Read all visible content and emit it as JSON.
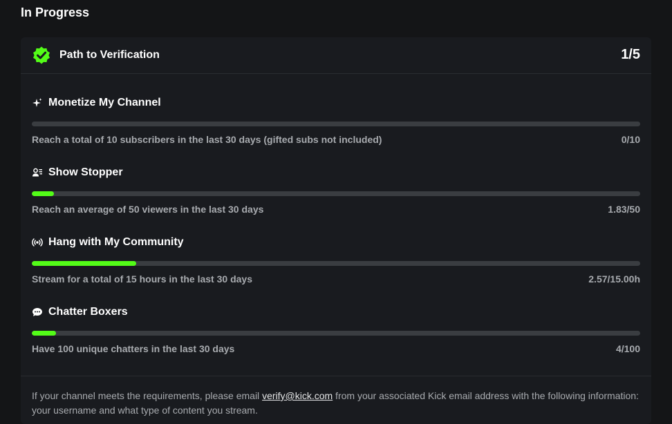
{
  "section": {
    "title": "In Progress"
  },
  "card": {
    "title": "Path to Verification",
    "count": "1/5",
    "accent": "#53fc18"
  },
  "tasks": [
    {
      "title": "Monetize My Channel",
      "icon": "sparkle-icon",
      "desc": "Reach a total of 10 subscribers in the last 30 days (gifted subs not included)",
      "value": "0/10",
      "progress": 0.0
    },
    {
      "title": "Show Stopper",
      "icon": "users-icon",
      "desc": "Reach an average of 50 viewers in the last 30 days",
      "value": "1.83/50",
      "progress": 0.0366
    },
    {
      "title": "Hang with My Community",
      "icon": "broadcast-icon",
      "desc": "Stream for a total of 15 hours in the last 30 days",
      "value": "2.57/15.00h",
      "progress": 0.1713
    },
    {
      "title": "Chatter Boxers",
      "icon": "chat-bubble-icon",
      "desc": "Have 100 unique chatters in the last 30 days",
      "value": "4/100",
      "progress": 0.04
    }
  ],
  "footer": {
    "text_before": "If your channel meets the requirements, please email ",
    "email": "verify@kick.com",
    "text_after": " from your associated Kick email address with the following information: your username and what type of content you stream."
  }
}
